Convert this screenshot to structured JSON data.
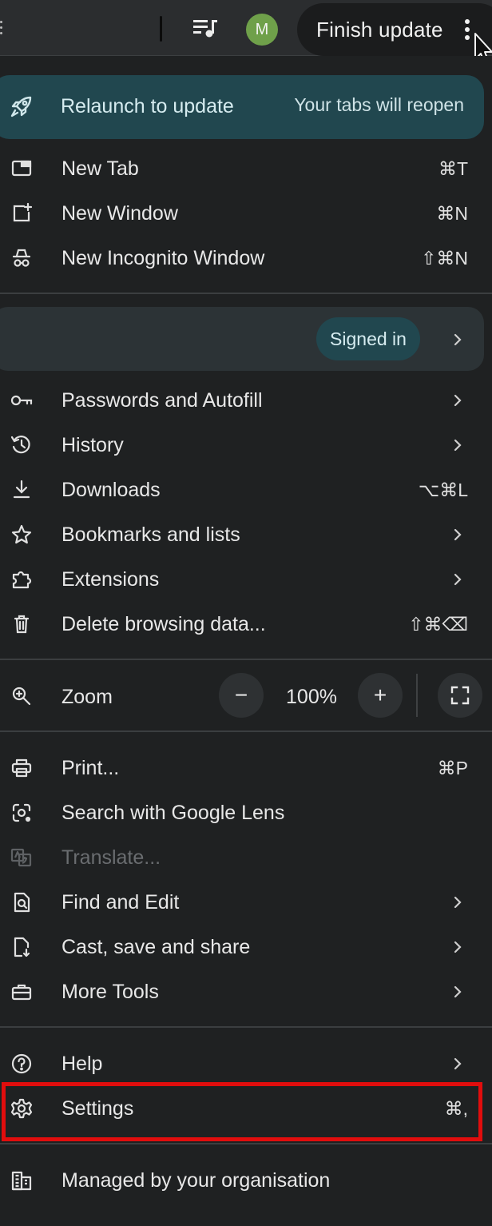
{
  "toolbar": {
    "avatar_initial": "M",
    "finish_update_label": "Finish update"
  },
  "relaunch": {
    "label": "Relaunch to update",
    "note": "Your tabs will reopen"
  },
  "menu_group1": [
    {
      "label": "New Tab",
      "shortcut": "⌘T"
    },
    {
      "label": "New Window",
      "shortcut": "⌘N"
    },
    {
      "label": "New Incognito Window",
      "shortcut": "⇧⌘N"
    }
  ],
  "profile": {
    "status": "Signed in"
  },
  "menu_group2": [
    {
      "label": "Passwords and Autofill",
      "shortcut": ""
    },
    {
      "label": "History",
      "shortcut": ""
    },
    {
      "label": "Downloads",
      "shortcut": "⌥⌘L"
    },
    {
      "label": "Bookmarks and lists",
      "shortcut": ""
    },
    {
      "label": "Extensions",
      "shortcut": ""
    },
    {
      "label": "Delete browsing data...",
      "shortcut": "⇧⌘⌫"
    }
  ],
  "zoom": {
    "label": "Zoom",
    "value": "100%",
    "minus": "−",
    "plus": "+"
  },
  "menu_group3": [
    {
      "label": "Print...",
      "shortcut": "⌘P"
    },
    {
      "label": "Search with Google Lens",
      "shortcut": ""
    },
    {
      "label": "Translate...",
      "shortcut": "",
      "disabled": true
    },
    {
      "label": "Find and Edit",
      "shortcut": ""
    },
    {
      "label": "Cast, save and share",
      "shortcut": ""
    },
    {
      "label": "More Tools",
      "shortcut": ""
    }
  ],
  "menu_group4": [
    {
      "label": "Help",
      "shortcut": ""
    },
    {
      "label": "Settings",
      "shortcut": "⌘,"
    }
  ],
  "managed": {
    "label": "Managed by your organisation"
  },
  "colors": {
    "background": "#1f2122",
    "relaunch_bg": "#21474f",
    "highlight_border": "#e10d0d",
    "avatar_bg": "#6fa04a"
  }
}
